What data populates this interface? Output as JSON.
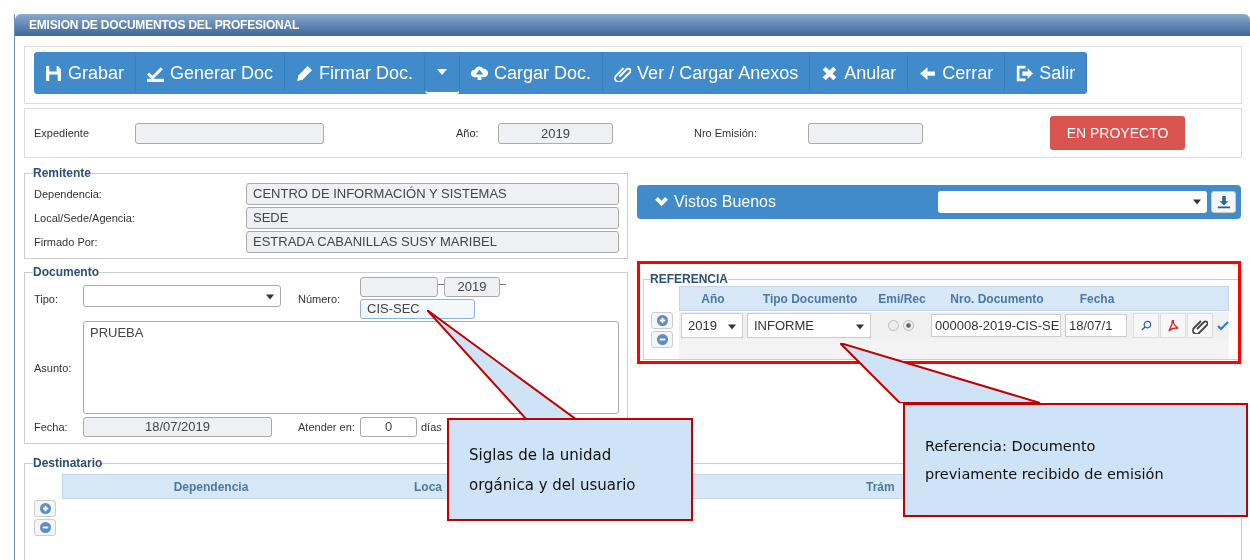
{
  "window": {
    "title": "EMISION DE DOCUMENTOS DEL PROFESIONAL"
  },
  "toolbar": [
    {
      "kind": "button",
      "label": "Grabar"
    },
    {
      "kind": "button",
      "label": "Generar Doc"
    },
    {
      "kind": "button",
      "label": "Firmar Doc."
    },
    {
      "kind": "dropdown"
    },
    {
      "kind": "button",
      "label": "Cargar Doc."
    },
    {
      "kind": "button",
      "label": "Ver / Cargar Anexos"
    },
    {
      "kind": "button",
      "label": "Anular"
    },
    {
      "kind": "button",
      "label": "Cerrar"
    },
    {
      "kind": "button",
      "label": "Salir"
    }
  ],
  "info": {
    "expediente": {
      "label": "Expediente"
    },
    "anio": {
      "label": "Año:",
      "value": "2019"
    },
    "nro_emision": {
      "label": "Nro Emisión:"
    },
    "status": "EN PROYECTO"
  },
  "remitente": {
    "title": "Remitente",
    "fields": [
      {
        "label": "Dependencia:",
        "value": "CENTRO DE INFORMACIÓN Y SISTEMAS"
      },
      {
        "label": "Local/Sede/Agencia:",
        "value": "SEDE"
      },
      {
        "label": "Firmado Por:",
        "value": "ESTRADA CABANILLAS SUSY MARIBEL"
      }
    ]
  },
  "documento": {
    "title": "Documento",
    "tipo": {
      "label": "Tipo:"
    },
    "numero": {
      "label": "Número:",
      "year": "2019",
      "siglas": "CIS-SEC"
    },
    "asunto": {
      "label": "Asunto:",
      "value": "PRUEBA"
    },
    "fecha": {
      "label": "Fecha:",
      "value": "18/07/2019"
    },
    "atender": {
      "label": "Atender en:",
      "value": "0",
      "unit": "días"
    }
  },
  "vistos_buenos": {
    "title": "Vistos Buenos"
  },
  "referencia": {
    "title": "REFERENCIA",
    "columns": [
      "Año",
      "Tipo Documento",
      "Emi/Rec",
      "Nro. Documento",
      "Fecha"
    ],
    "rows": [
      {
        "anio": "2019",
        "tipo": "INFORME",
        "radios": [
          {
            "selected": false
          },
          {
            "selected": true
          }
        ],
        "nro": "000008-2019-CIS-SE",
        "fecha": "18/07/1"
      }
    ]
  },
  "destinatario": {
    "title": "Destinatario",
    "columns": [
      "Dependencia",
      "Loca",
      "Trám"
    ]
  },
  "callouts": [
    {
      "lines": [
        "Siglas de la unidad",
        "orgánica y del usuario"
      ]
    },
    {
      "lines": [
        "Referencia: Documento",
        "previamente recibido de emisión"
      ]
    }
  ]
}
